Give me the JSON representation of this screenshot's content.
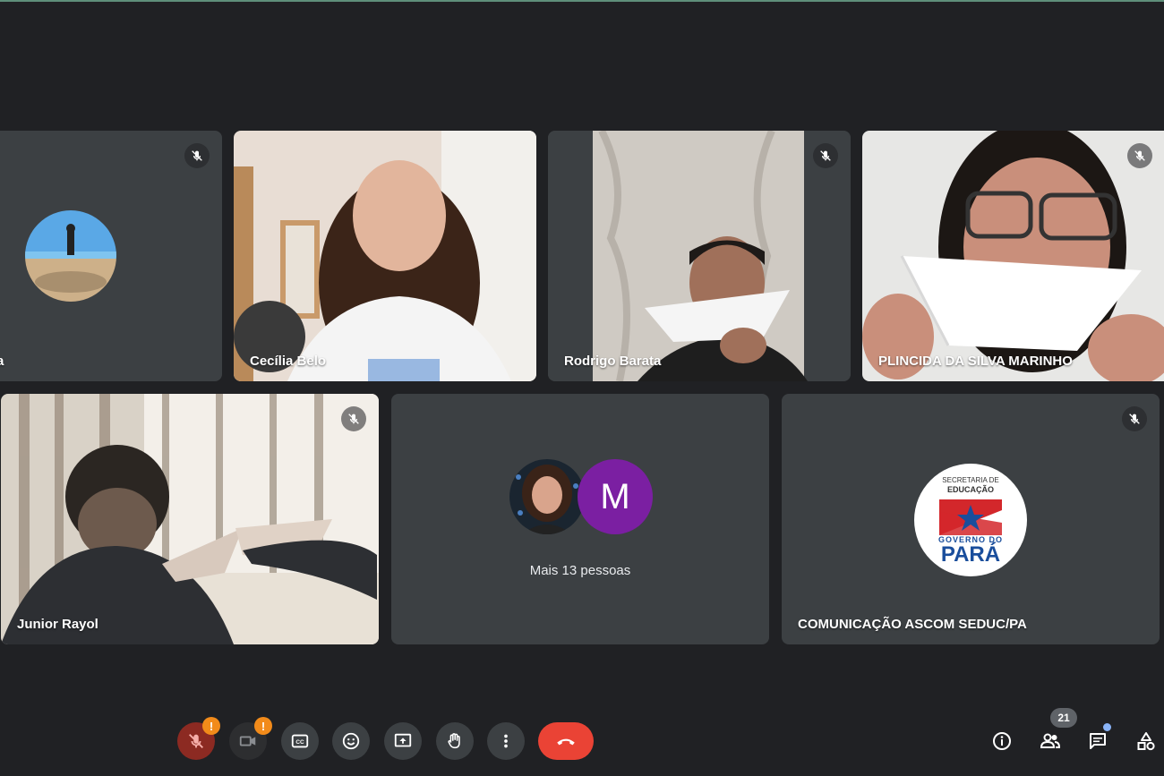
{
  "participants": {
    "p1": {
      "name_fragment": "a"
    },
    "p2": {
      "name": "Cecília Belo"
    },
    "p3": {
      "name": "Rodrigo Barata"
    },
    "p4": {
      "name": "PLINCIDA DA SILVA MARINHO"
    },
    "p5": {
      "name": "Junior Rayol"
    },
    "p6": {
      "more_label": "Mais 13 pessoas",
      "avatar_letter": "M"
    },
    "p7": {
      "name": "COMUNICAÇÃO ASCOM SEDUC/PA",
      "logo_line1": "SECRETARIA DE",
      "logo_line2": "EDUCAÇÃO",
      "logo_line3": "GOVERNO DO",
      "logo_line4": "PARÁ"
    }
  },
  "controls": {
    "mic_warning": "!",
    "camera_warning": "!",
    "participant_count": "21"
  },
  "colors": {
    "background": "#202124",
    "tile": "#3c4043",
    "hangup": "#ea4335",
    "warning": "#f28b1a",
    "avatar_m": "#7b1fa2",
    "chat_dot": "#8ab4f8"
  },
  "icons": [
    "mic-off-icon",
    "camera-icon",
    "captions-icon",
    "emoji-icon",
    "present-icon",
    "raise-hand-icon",
    "more-vert-icon",
    "hangup-icon",
    "info-icon",
    "people-icon",
    "chat-icon",
    "activities-icon"
  ]
}
